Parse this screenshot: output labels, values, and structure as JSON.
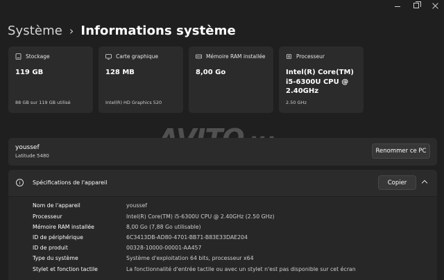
{
  "breadcrumb": {
    "parent": "Système",
    "separator": "›",
    "current": "Informations système"
  },
  "cards": [
    {
      "title": "Stockage",
      "value": "119 GB",
      "sub": "88 GB sur 119 GB utilisé",
      "icon": "storage-icon"
    },
    {
      "title": "Carte graphique",
      "value": "128 MB",
      "sub": "Intel(R) HD Graphics 520",
      "icon": "gpu-icon"
    },
    {
      "title": "Mémoire RAM installée",
      "value": "8,00 Go",
      "sub": "",
      "icon": "ram-icon"
    },
    {
      "title": "Processeur",
      "value": "Intel(R) Core(TM) i5-6300U CPU @ 2.40GHz",
      "sub": "2.50 GHz",
      "icon": "cpu-icon"
    }
  ],
  "device": {
    "name": "youssef",
    "model": "Latitude 5480",
    "rename_label": "Renommer ce PC"
  },
  "specs": {
    "title": "Spécifications de l'appareil",
    "copy_label": "Copier",
    "rows": [
      {
        "label": "Nom de l'appareil",
        "value": "youssef"
      },
      {
        "label": "Processeur",
        "value": "Intel(R) Core(TM) i5-6300U CPU @ 2.40GHz (2.50 GHz)"
      },
      {
        "label": "Mémoire RAM installée",
        "value": "8,00 Go (7,88 Go utilisable)"
      },
      {
        "label": "ID de périphérique",
        "value": "6C3413DB-AD80-4701-BB71-B83E33DAE204"
      },
      {
        "label": "ID de produit",
        "value": "00328-10000-00001-AA457"
      },
      {
        "label": "Type du système",
        "value": "Système d'exploitation 64 bits, processeur x64"
      },
      {
        "label": "Stylet et fonction tactile",
        "value": "La fonctionnalité d'entrée tactile ou avec un stylet n'est pas disponible sur cet écran"
      }
    ]
  },
  "watermark": {
    "main": "AVITO",
    "suffix": ".MA"
  }
}
